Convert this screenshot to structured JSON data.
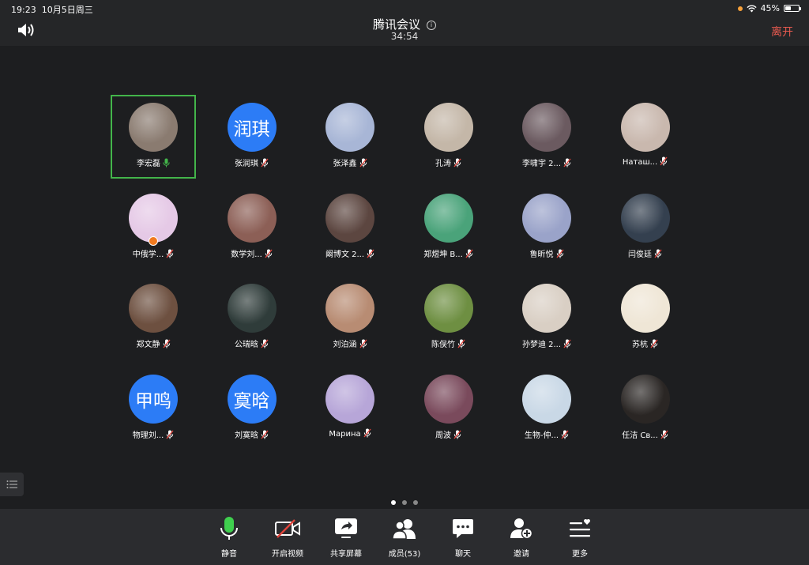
{
  "status": {
    "time": "19:23",
    "date": "10月5日周三",
    "battery": "45%",
    "battery_level": 0.45
  },
  "header": {
    "title": "腾讯会议",
    "timer": "34:54",
    "leave_label": "离开"
  },
  "participants": [
    {
      "name": "李宏磊",
      "mic": "on",
      "active": true,
      "avatar": "photo-bunnies",
      "color": "#8a7b70"
    },
    {
      "name": "张润琪",
      "mic": "muted",
      "avatar_text": "润琪",
      "color": "#2c7cf6"
    },
    {
      "name": "张泽鑫",
      "mic": "muted",
      "avatar": "photo-sky",
      "color": "#a8b6d6"
    },
    {
      "name": "孔涛",
      "mic": "muted",
      "avatar": "photo-room",
      "color": "#c4b7a8"
    },
    {
      "name": "李啸宇 2...",
      "mic": "muted",
      "avatar": "photo-hands",
      "color": "#6b5a60"
    },
    {
      "name": "Натaш...",
      "mic": "muted",
      "avatar": "photo-girl",
      "color": "#c9b8ae"
    },
    {
      "name": "中俄学...",
      "mic": "muted",
      "host": true,
      "avatar": "photo-castle",
      "color": "#e5c9e6"
    },
    {
      "name": "数学刘...",
      "mic": "muted",
      "avatar": "photo-woman",
      "color": "#8c5f56"
    },
    {
      "name": "阚博文 2...",
      "mic": "muted",
      "avatar": "photo-girl2",
      "color": "#5c4640"
    },
    {
      "name": "郑煜坤 B...",
      "mic": "muted",
      "avatar": "photo-dino",
      "color": "#4aa37a"
    },
    {
      "name": "鲁昕悦",
      "mic": "muted",
      "avatar": "photo-sunset",
      "color": "#9aa3c9"
    },
    {
      "name": "闫俊廷",
      "mic": "muted",
      "avatar": "photo-moon",
      "color": "#34404f"
    },
    {
      "name": "郑文静",
      "mic": "muted",
      "avatar": "photo-face",
      "color": "#6d5040"
    },
    {
      "name": "公瑞晗",
      "mic": "muted",
      "avatar": "photo-forest",
      "color": "#2f3c3a"
    },
    {
      "name": "刘泊涵",
      "mic": "muted",
      "avatar": "photo-kid",
      "color": "#b88c73"
    },
    {
      "name": "陈俣竹",
      "mic": "muted",
      "avatar": "photo-sheep",
      "color": "#6e8f42"
    },
    {
      "name": "孙梦迪 2...",
      "mic": "muted",
      "avatar": "photo-drawing",
      "color": "#d9cfc4"
    },
    {
      "name": "苏杭",
      "mic": "muted",
      "avatar": "photo-chick",
      "color": "#efe6d6"
    },
    {
      "name": "物理刘...",
      "mic": "muted",
      "avatar_text": "甲鸣",
      "color": "#2c7cf6"
    },
    {
      "name": "刘寞晗",
      "mic": "muted",
      "avatar_text": "寞晗",
      "color": "#2c7cf6"
    },
    {
      "name": "Марина",
      "mic": "muted",
      "avatar": "photo-kuromi",
      "color": "#b7a6d8"
    },
    {
      "name": "周波",
      "mic": "muted",
      "avatar": "photo-poster",
      "color": "#7a4a5c"
    },
    {
      "name": "生物-仲...",
      "mic": "muted",
      "avatar": "photo-anime",
      "color": "#c9d8e6"
    },
    {
      "name": "任洁 Св...",
      "mic": "muted",
      "avatar": "photo-dark",
      "color": "#2a2624"
    }
  ],
  "pagination": {
    "pages": 3,
    "current": 1
  },
  "toolbar": {
    "mute": "静音",
    "video": "开启视频",
    "share": "共享屏幕",
    "members": "成员(53)",
    "chat": "聊天",
    "invite": "邀请",
    "more": "更多"
  },
  "colors": {
    "accent_green": "#43b54a",
    "leave_red": "#e85a4f",
    "avatar_blue": "#2c7cf6",
    "muted_red": "#e0443c"
  }
}
